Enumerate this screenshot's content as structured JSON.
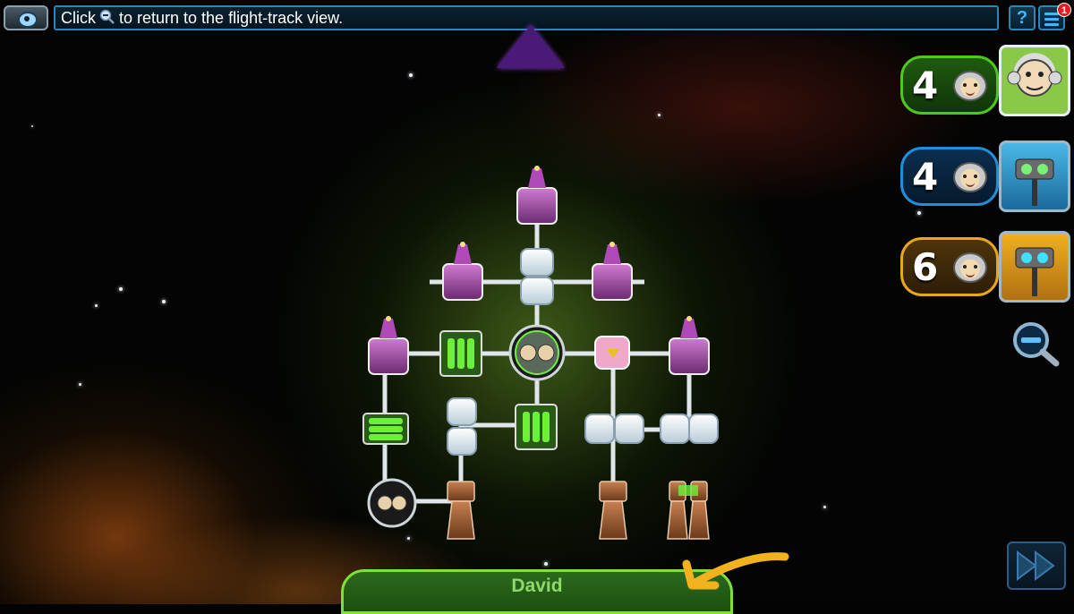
{
  "hint": {
    "prefix": "Click",
    "suffix": "to return to the flight-track view.",
    "icon": "zoom-out-icon"
  },
  "topbar": {
    "help_label": "?",
    "notification_count": "1"
  },
  "players": [
    {
      "count": "4",
      "color": "#4fc81e",
      "avatar": "monkey-avatar"
    },
    {
      "count": "4",
      "color": "#1e8fd8",
      "avatar": "robot-blue-avatar"
    },
    {
      "count": "6",
      "color": "#e8a81c",
      "avatar": "robot-yellow-avatar"
    }
  ],
  "current_player": {
    "name": "David",
    "color": "#7fe03c"
  },
  "colors": {
    "accent": "#2a88b8",
    "arrow": "#f2b21e",
    "ship_glow": "#7aa83a"
  }
}
